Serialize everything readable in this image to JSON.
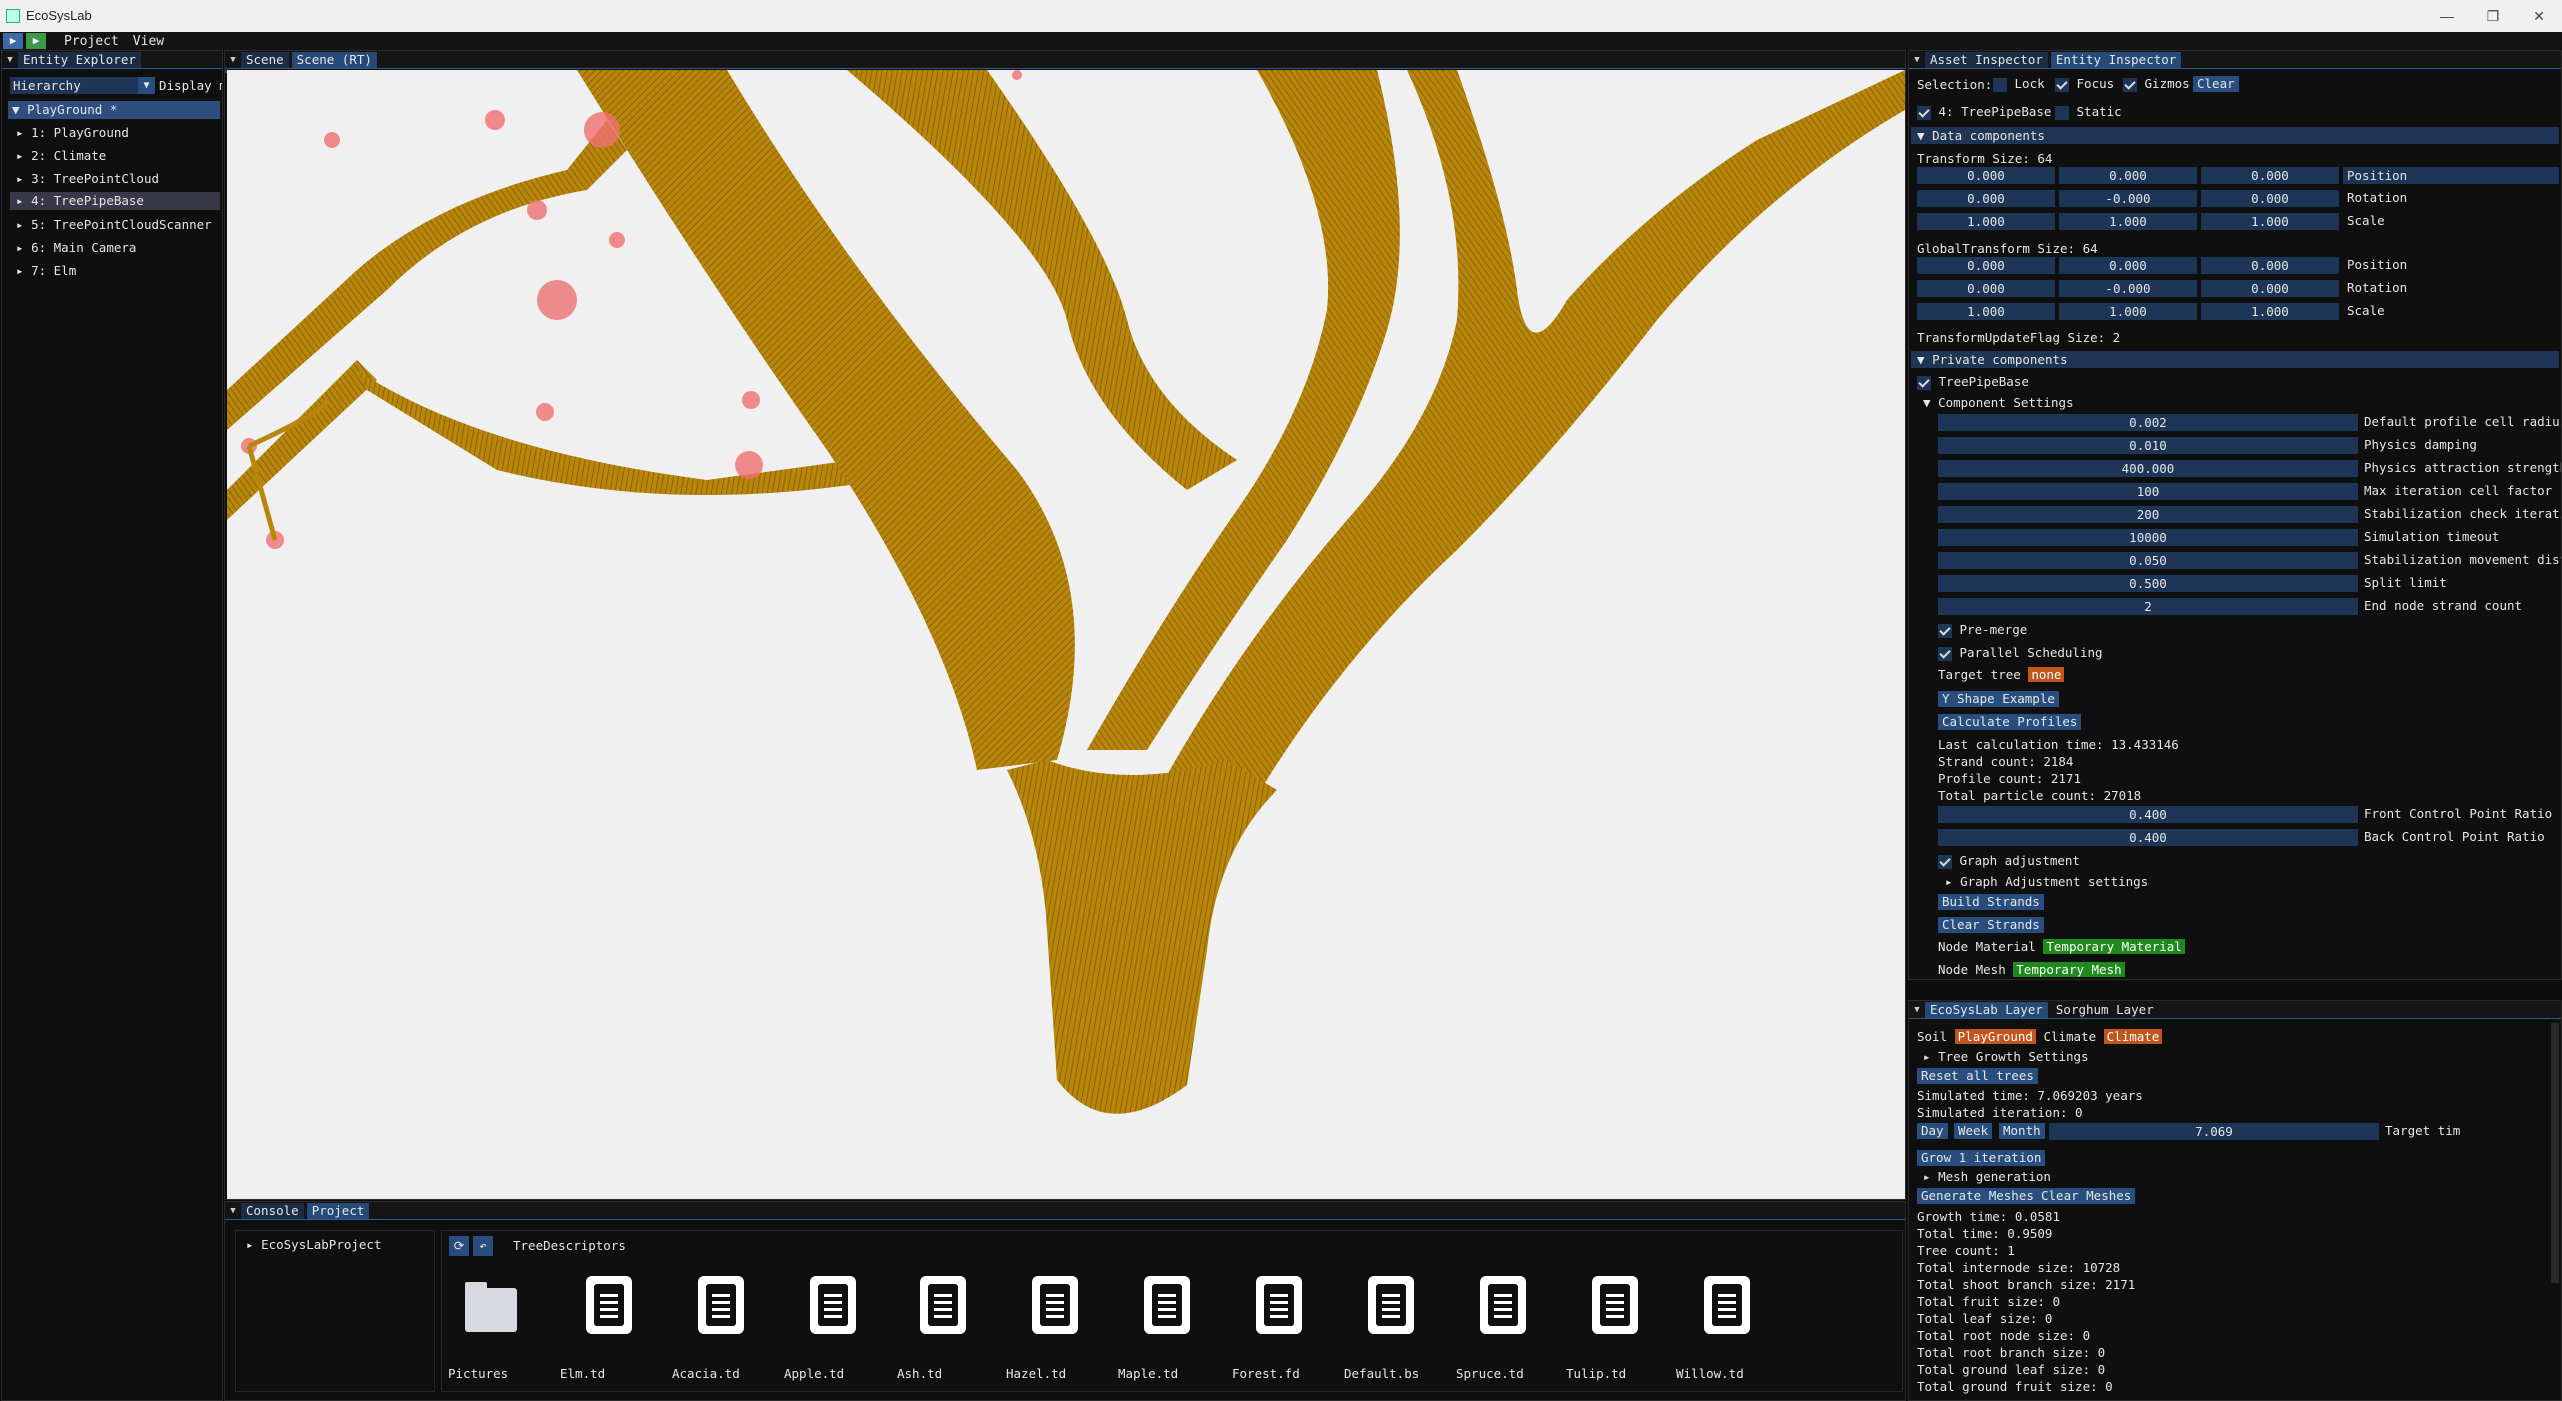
{
  "window": {
    "title": "EcoSysLab",
    "minimize": "—",
    "maximize": "❐",
    "close": "✕"
  },
  "menu": {
    "play": "▶",
    "pause": "▶",
    "project": "Project",
    "view": "View"
  },
  "explorer": {
    "tab": "Entity Explorer",
    "mode": "Hierarchy",
    "display": "Display m",
    "root": "PlayGround *",
    "items": [
      "1: PlayGround",
      "2: Climate",
      "3: TreePointCloud",
      "4: TreePipeBase",
      "5: TreePointCloudScanner",
      "6: Main Camera",
      "7: Elm"
    ]
  },
  "scene": {
    "tabs": [
      "Scene",
      "Scene (RT)"
    ]
  },
  "inspector": {
    "tabs": [
      "Asset Inspector",
      "Entity Inspector"
    ],
    "selection_label": "Selection:",
    "lock": "Lock",
    "focus": "Focus",
    "gizmos": "Gizmos",
    "clear": "Clear",
    "entity_name": "4: TreePipeBase",
    "static": "Static",
    "data_components": "Data components",
    "transform_size": "Transform Size: 64",
    "transform": [
      [
        "0.000",
        "0.000",
        "0.000",
        "Position"
      ],
      [
        "0.000",
        "-0.000",
        "0.000",
        "Rotation"
      ],
      [
        "1.000",
        "1.000",
        "1.000",
        "Scale"
      ]
    ],
    "global_transform_size": "GlobalTransform Size: 64",
    "global_transform": [
      [
        "0.000",
        "0.000",
        "0.000",
        "Position"
      ],
      [
        "0.000",
        "-0.000",
        "0.000",
        "Rotation"
      ],
      [
        "1.000",
        "1.000",
        "1.000",
        "Scale"
      ]
    ],
    "update_flag": "TransformUpdateFlag Size: 2",
    "private_components": "Private components",
    "tpb": "TreePipeBase",
    "component_settings": "Component Settings",
    "settings": [
      [
        "0.002",
        "Default profile cell radius"
      ],
      [
        "0.010",
        "Physics damping"
      ],
      [
        "400.000",
        "Physics attraction strength"
      ],
      [
        "100",
        "Max iteration cell factor"
      ],
      [
        "200",
        "Stabilization check iteratio"
      ],
      [
        "10000",
        "Simulation timeout"
      ],
      [
        "0.050",
        "Stabilization movement dista"
      ],
      [
        "0.500",
        "Split limit"
      ],
      [
        "2",
        "End node strand count"
      ]
    ],
    "pre_merge": "Pre-merge",
    "parallel": "Parallel Scheduling",
    "target_tree": "Target tree",
    "target_none": "none",
    "y_shape": "Y Shape Example",
    "calc_profiles": "Calculate Profiles",
    "stats": [
      "Last calculation time: 13.433146",
      "Strand count: 2184",
      "Profile count: 2171",
      "Total particle count: 27018"
    ],
    "ratios": [
      [
        "0.400",
        "Front Control Point Ratio"
      ],
      [
        "0.400",
        "Back Control Point Ratio"
      ]
    ],
    "graph_adj": "Graph adjustment",
    "graph_adj_settings": "Graph Adjustment settings",
    "build_strands": "Build Strands",
    "clear_strands": "Clear Strands",
    "node_material": "Node Material",
    "temp_material": "Temporary Material",
    "node_mesh": "Node Mesh",
    "temp_mesh": "Temporary Mesh"
  },
  "layer": {
    "tabs": [
      "EcoSysLab Layer",
      "Sorghum Layer"
    ],
    "soil": "Soil",
    "playground": "PlayGround",
    "climate_label": "Climate",
    "climate": "Climate",
    "tree_growth": "Tree Growth Settings",
    "reset": "Reset all trees",
    "sim_time": "Simulated time: 7.069203 years",
    "sim_iter": "Simulated iteration: 0",
    "day": "Day",
    "week": "Week",
    "month": "Month",
    "target_value": "7.069",
    "target_label": "Target tim",
    "grow": "Grow 1 iteration",
    "mesh_gen": "Mesh generation",
    "gen_meshes": "Generate Meshes",
    "clear_meshes": "Clear Meshes",
    "stats": [
      "Growth time: 0.0581",
      "Total time: 0.9509",
      "Tree count: 1",
      "Total internode size: 10728",
      "Total shoot branch size: 2171",
      "Total fruit size: 0",
      "Total leaf size: 0",
      "Total root node size: 0",
      "Total root branch size: 0",
      "Total ground leaf size: 0",
      "Total ground fruit size: 0"
    ]
  },
  "bottom": {
    "tabs": [
      "Console",
      "Project"
    ],
    "tree_root": "EcoSysLabProject",
    "path": "TreeDescriptors",
    "files": [
      "Pictures",
      "Elm.td",
      "Acacia.td",
      "Apple.td",
      "Ash.td",
      "Hazel.td",
      "Maple.td",
      "Forest.fd",
      "Default.bs",
      "Spruce.td",
      "Tulip.td",
      "Willow.td"
    ]
  },
  "colors": {
    "accent": "#264a78",
    "trunk": "#b8860b",
    "orange": "#c2541d",
    "green": "#1e8a1e"
  }
}
